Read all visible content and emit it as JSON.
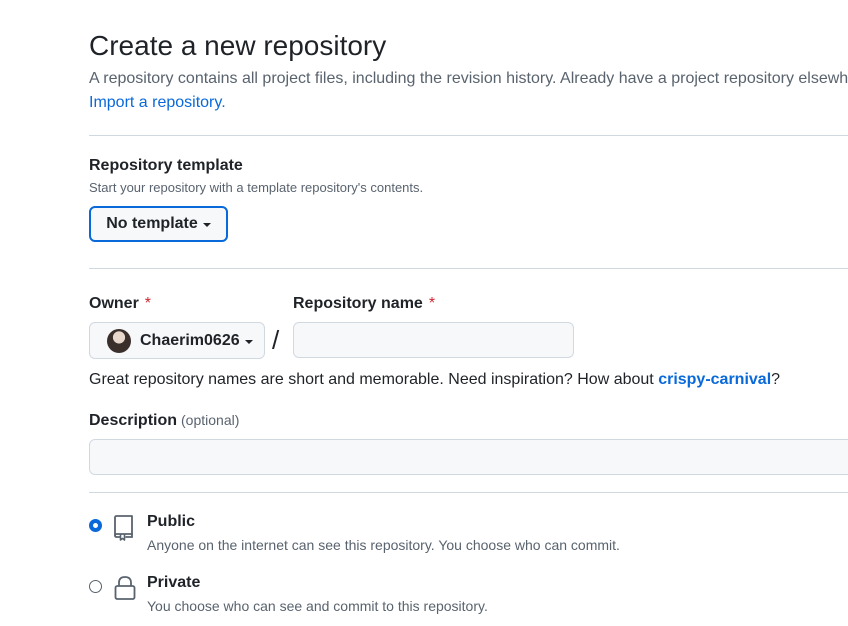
{
  "header": {
    "title": "Create a new repository",
    "subtitle": "A repository contains all project files, including the revision history. Already have a project repository elsewhere?",
    "import_link": "Import a repository."
  },
  "template": {
    "label": "Repository template",
    "note": "Start your repository with a template repository's contents.",
    "button_label": "No template"
  },
  "owner": {
    "label": "Owner",
    "required_mark": "*",
    "value": "Chaerim0626"
  },
  "repo_name": {
    "label": "Repository name",
    "required_mark": "*",
    "separator": "/",
    "value": "",
    "placeholder": ""
  },
  "name_hint": {
    "prefix": "Great repository names are short and memorable. Need inspiration? How about ",
    "suggestion": "crispy-carnival",
    "suffix": "?"
  },
  "description": {
    "label": "Description",
    "optional": "(optional)",
    "value": "",
    "placeholder": ""
  },
  "visibility": {
    "options": [
      {
        "title": "Public",
        "desc": "Anyone on the internet can see this repository. You choose who can commit.",
        "icon": "repo-book-icon",
        "checked": true
      },
      {
        "title": "Private",
        "desc": "You choose who can see and commit to this repository.",
        "icon": "lock-icon",
        "checked": false
      }
    ]
  },
  "colors": {
    "accent": "#0969da",
    "required": "#d1242f",
    "muted": "#59636e"
  }
}
